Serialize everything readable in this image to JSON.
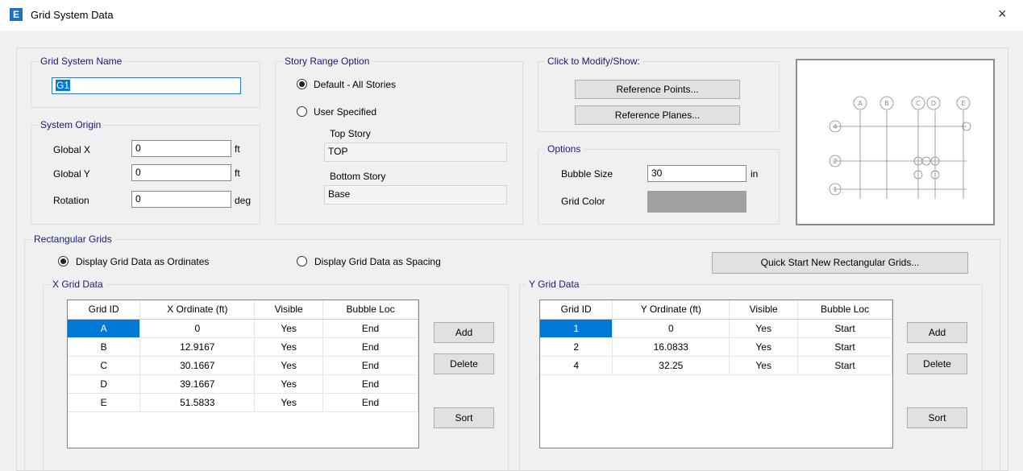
{
  "window": {
    "icon_letter": "E",
    "title": "Grid System Data",
    "close_glyph": "×"
  },
  "grid_system_name": {
    "legend": "Grid System Name",
    "value": "G1"
  },
  "system_origin": {
    "legend": "System Origin",
    "global_x": {
      "label": "Global X",
      "value": "0",
      "unit": "ft"
    },
    "global_y": {
      "label": "Global Y",
      "value": "0",
      "unit": "ft"
    },
    "rotation": {
      "label": "Rotation",
      "value": "0",
      "unit": "deg"
    }
  },
  "story_range": {
    "legend": "Story Range Option",
    "default_label": "Default - All Stories",
    "user_label": "User Specified",
    "selected": "default",
    "top_story_label": "Top Story",
    "top_story_value": "TOP",
    "bottom_story_label": "Bottom Story",
    "bottom_story_value": "Base"
  },
  "modify_show": {
    "legend": "Click to Modify/Show:",
    "reference_points": "Reference Points...",
    "reference_planes": "Reference Planes..."
  },
  "options": {
    "legend": "Options",
    "bubble_size_label": "Bubble Size",
    "bubble_size_value": "30",
    "bubble_size_unit": "in",
    "grid_color_label": "Grid Color",
    "grid_color": "#a0a0a0"
  },
  "preview": {
    "x_bubbles": [
      "A",
      "B",
      "C",
      "D",
      "E"
    ],
    "y_bubbles": [
      "4",
      "2",
      "1"
    ]
  },
  "rectangular_grids": {
    "legend": "Rectangular Grids",
    "ordinates_label": "Display Grid Data as Ordinates",
    "spacing_label": "Display Grid Data as Spacing",
    "selected": "ordinates",
    "quick_start": "Quick Start New Rectangular Grids..."
  },
  "x_grid": {
    "legend": "X Grid Data",
    "columns": [
      "Grid ID",
      "X Ordinate (ft)",
      "Visible",
      "Bubble Loc"
    ],
    "rows": [
      [
        "A",
        "0",
        "Yes",
        "End"
      ],
      [
        "B",
        "12.9167",
        "Yes",
        "End"
      ],
      [
        "C",
        "30.1667",
        "Yes",
        "End"
      ],
      [
        "D",
        "39.1667",
        "Yes",
        "End"
      ],
      [
        "E",
        "51.5833",
        "Yes",
        "End"
      ]
    ],
    "add": "Add",
    "delete": "Delete",
    "sort": "Sort"
  },
  "y_grid": {
    "legend": "Y Grid Data",
    "columns": [
      "Grid ID",
      "Y Ordinate (ft)",
      "Visible",
      "Bubble Loc"
    ],
    "rows": [
      [
        "1",
        "0",
        "Yes",
        "Start"
      ],
      [
        "2",
        "16.0833",
        "Yes",
        "Start"
      ],
      [
        "4",
        "32.25",
        "Yes",
        "Start"
      ]
    ],
    "add": "Add",
    "delete": "Delete",
    "sort": "Sort"
  }
}
